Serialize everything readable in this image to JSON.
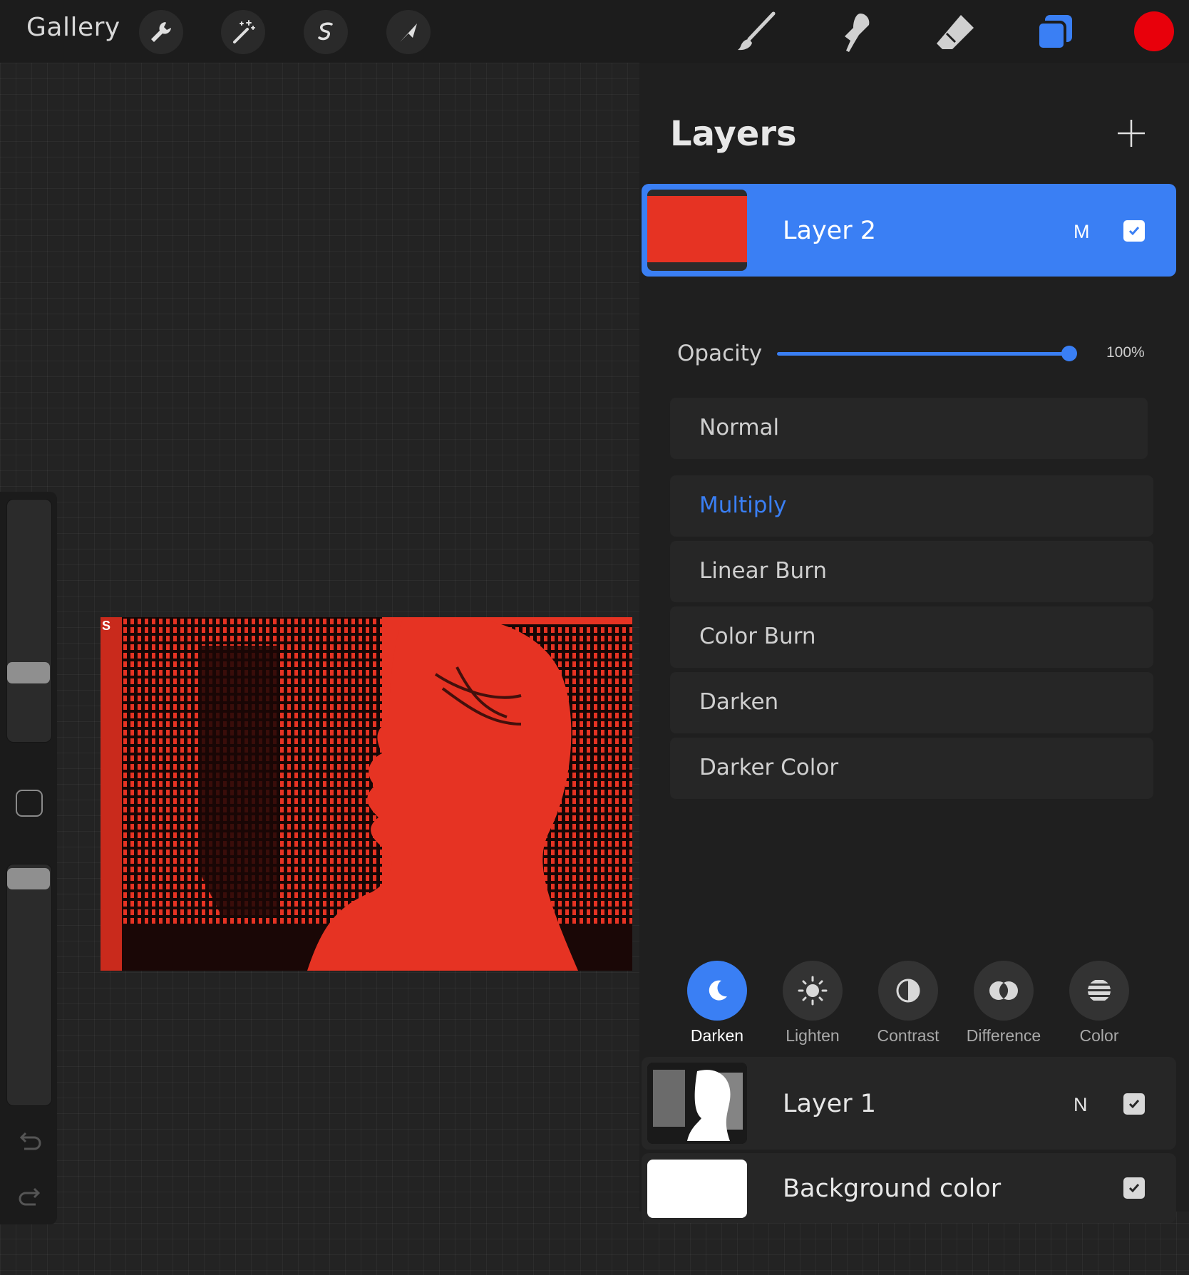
{
  "topbar": {
    "gallery_label": "Gallery",
    "left_tools": [
      "wrench-icon",
      "magic-wand-icon",
      "selection-icon",
      "transform-arrow-icon"
    ],
    "right_tools": [
      "brush-icon",
      "smudge-icon",
      "eraser-icon",
      "layers-icon"
    ],
    "current_color": "#e8000b"
  },
  "sidebar": {
    "brush_size_level": 0.26,
    "brush_opacity_level": 0.98
  },
  "layers_panel": {
    "title": "Layers",
    "add_icon": "plus-icon",
    "active_layer": {
      "name": "Layer 2",
      "blend_mode_abbr": "M",
      "visible": true
    },
    "opacity": {
      "label": "Opacity",
      "value_text": "100%",
      "value": 1.0
    },
    "blend_modes": [
      {
        "label": "Normal",
        "selected": false
      },
      {
        "label": "Multiply",
        "selected": true
      },
      {
        "label": "Linear Burn",
        "selected": false
      },
      {
        "label": "Color Burn",
        "selected": false
      },
      {
        "label": "Darken",
        "selected": false
      },
      {
        "label": "Darker Color",
        "selected": false
      }
    ],
    "categories": [
      {
        "label": "Darken",
        "icon": "moon-icon",
        "active": true
      },
      {
        "label": "Lighten",
        "icon": "sun-icon",
        "active": false
      },
      {
        "label": "Contrast",
        "icon": "contrast-icon",
        "active": false
      },
      {
        "label": "Difference",
        "icon": "difference-icon",
        "active": false
      },
      {
        "label": "Color",
        "icon": "color-stripes-icon",
        "active": false
      }
    ],
    "layers": [
      {
        "name": "Layer 1",
        "blend_mode_abbr": "N",
        "visible": true
      },
      {
        "name": "Background color",
        "blend_mode_abbr": "",
        "visible": true
      }
    ]
  },
  "colors": {
    "accent": "#3a7ff4",
    "layer_fill": "#e63323",
    "panel_bg": "#1f1f1f"
  }
}
